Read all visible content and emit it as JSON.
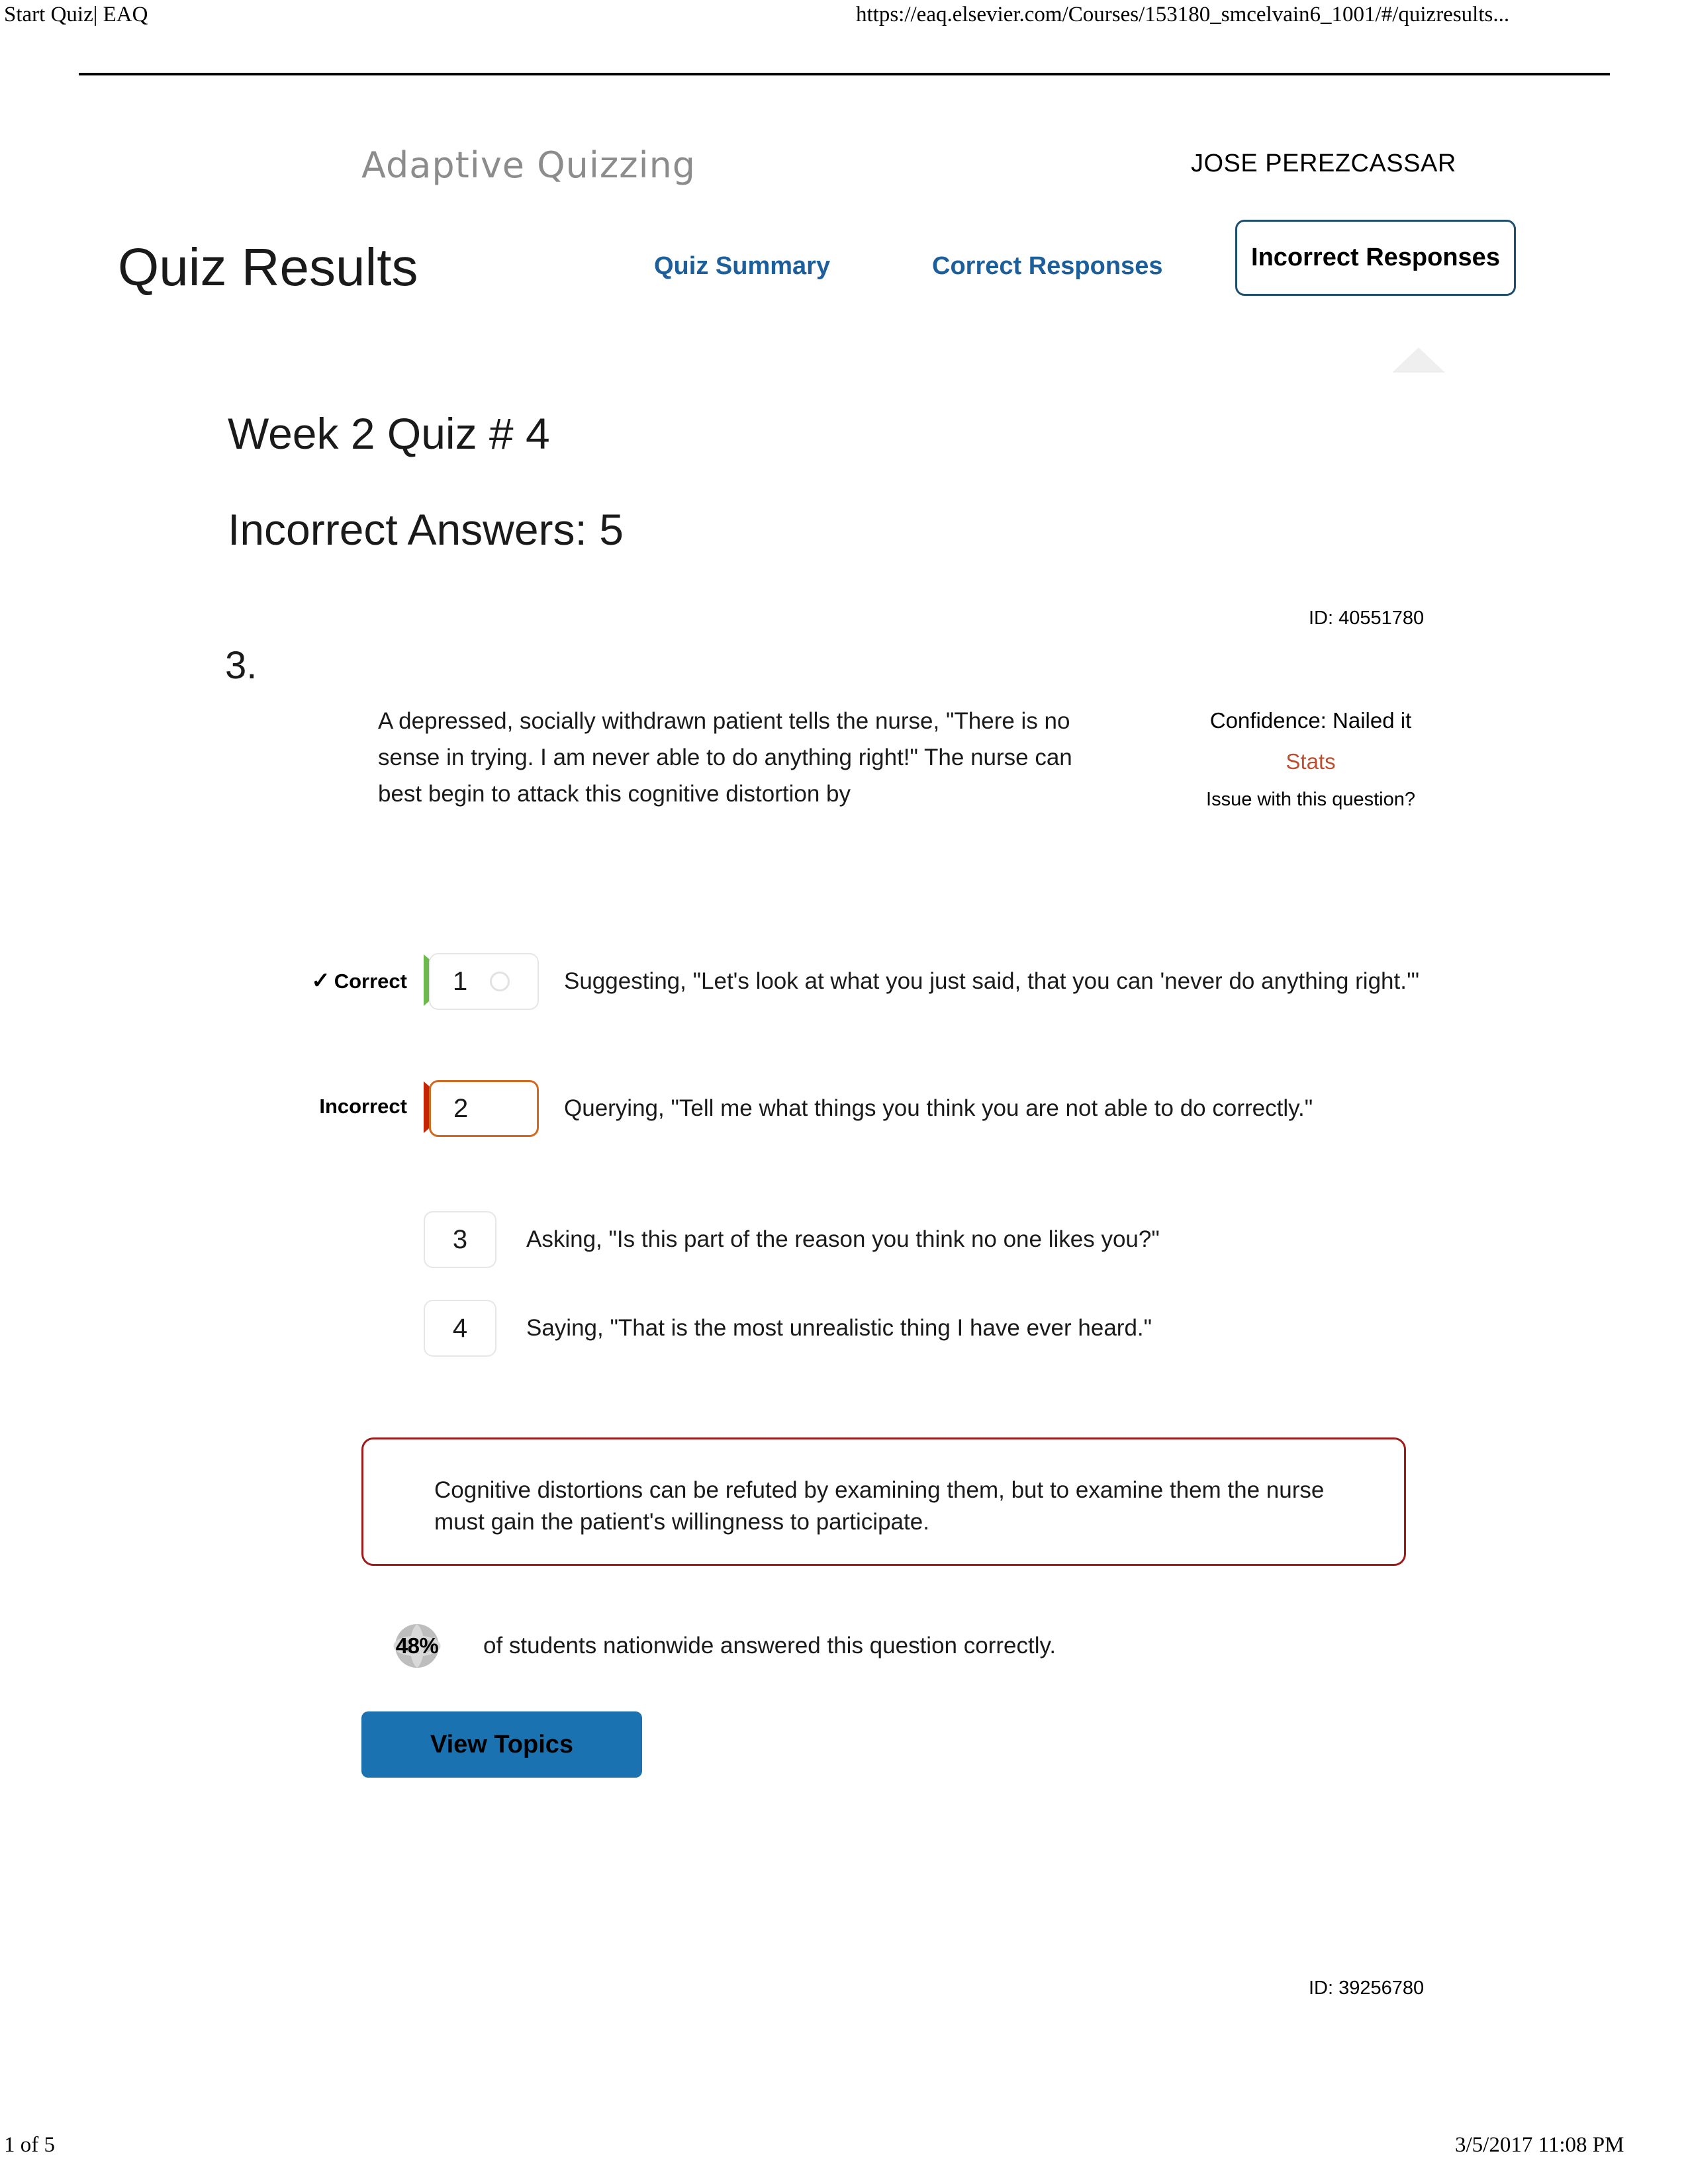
{
  "print_header": {
    "left": "Start Quiz| EAQ",
    "right": "https://eaq.elsevier.com/Courses/153180_smcelvain6_1001/#/quizresults..."
  },
  "app": {
    "logo": "Adaptive Quizzing",
    "username": "JOSE PEREZCASSAR",
    "page_title": "Quiz Results"
  },
  "nav": {
    "quiz_summary": "Quiz Summary",
    "correct_responses": "Correct Responses",
    "incorrect_responses": "Incorrect Responses"
  },
  "quiz": {
    "name": "Week 2 Quiz # 4",
    "incorrect_answers": "Incorrect Answers: 5",
    "id_top": "ID: 40551780",
    "id_bottom": "ID: 39256780"
  },
  "question": {
    "number": "3.",
    "stem": "A depressed, socially withdrawn patient tells the nurse, \"There is no sense in trying. I am never able to do anything right!\" The nurse can best begin to attack this cognitive distortion by",
    "confidence": "Confidence: Nailed it",
    "stats_link": "Stats",
    "issue_link": "Issue with this question?",
    "options": [
      {
        "number": "1",
        "text": "Suggesting, \"Let's look at what you just said, that you can 'never do anything right.'\"",
        "verdict": "Correct",
        "verdict_mark": "✓"
      },
      {
        "number": "2",
        "text": "Querying, \"Tell me what things you think you are not able to do correctly.\"",
        "verdict": "Incorrect",
        "verdict_mark": ""
      },
      {
        "number": "3",
        "text": "Asking, \"Is this part of the reason you think no one likes you?\"",
        "verdict": "",
        "verdict_mark": ""
      },
      {
        "number": "4",
        "text": "Saying, \"That is the most unrealistic thing I have ever heard.\"",
        "verdict": "",
        "verdict_mark": ""
      }
    ],
    "rationale": "Cognitive distortions can be refuted by examining them, but to examine them the nurse must gain the patient's willingness to participate.",
    "nationwide_pct": "48%",
    "nationwide_text": "of students nationwide answered this question correctly.",
    "view_topics": "View Topics"
  },
  "colors": {
    "link_blue": "#1c5f9a",
    "tab_border": "#1d4e6d",
    "correct_green": "#6cb94e",
    "incorrect_red": "#c42404",
    "selected_orange": "#d2691e",
    "stats_red": "#bd4f31",
    "rationale_border": "#a01a1a",
    "button_blue": "#1b72b0"
  },
  "print_footer": {
    "left": "1 of 5",
    "right": "3/5/2017 11:08 PM"
  }
}
